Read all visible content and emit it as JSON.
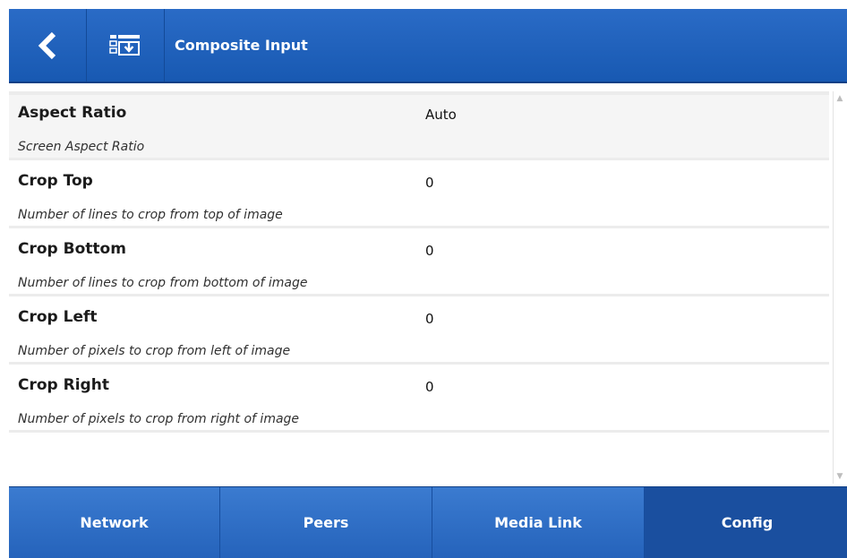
{
  "header": {
    "back_icon": "chevron-left-icon",
    "input_icon": "input-select-icon",
    "title": "Composite Input",
    "accent": "#1f62bd"
  },
  "settings": [
    {
      "name": "Aspect Ratio",
      "value": "Auto",
      "description": "Screen Aspect Ratio"
    },
    {
      "name": "Crop Top",
      "value": "0",
      "description": "Number of lines to crop from top of image"
    },
    {
      "name": "Crop Bottom",
      "value": "0",
      "description": "Number of lines to crop from bottom of image"
    },
    {
      "name": "Crop Left",
      "value": "0",
      "description": "Number of pixels to crop from left of image"
    },
    {
      "name": "Crop Right",
      "value": "0",
      "description": "Number of pixels to crop from right of image"
    }
  ],
  "nav": {
    "tabs": [
      {
        "label": "Network",
        "active": false
      },
      {
        "label": "Peers",
        "active": false
      },
      {
        "label": "Media Link",
        "active": false
      },
      {
        "label": "Config",
        "active": true
      }
    ],
    "active_color": "#1a4f9f"
  }
}
